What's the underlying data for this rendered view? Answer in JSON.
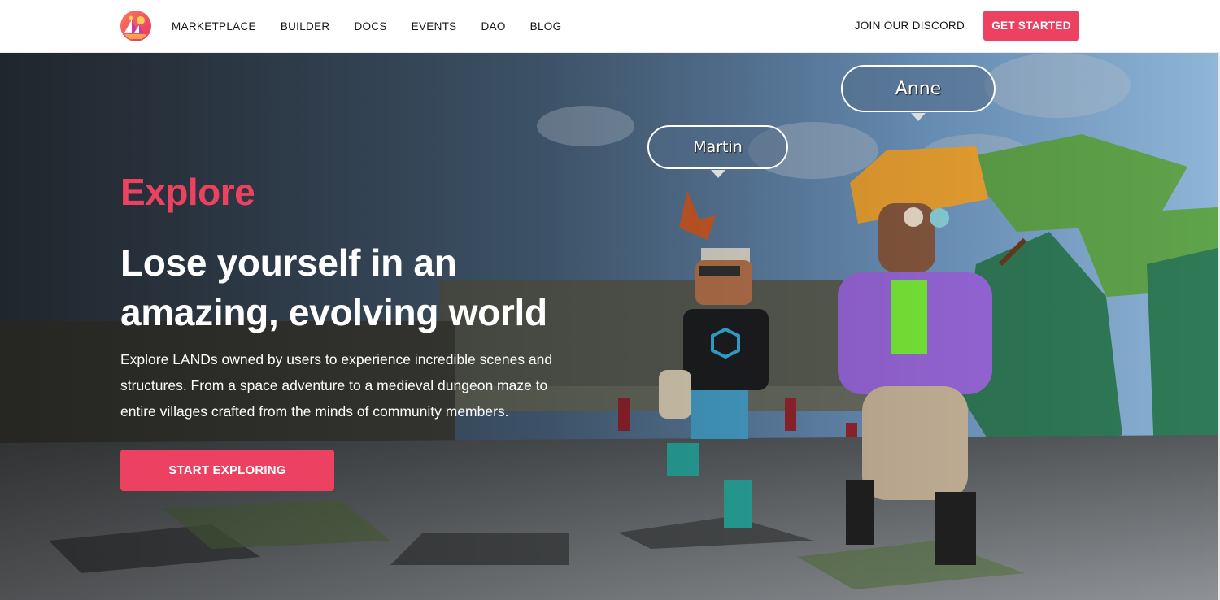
{
  "navbar": {
    "logo": "decentraland-logo-icon",
    "links": [
      "MARKETPLACE",
      "BUILDER",
      "DOCS",
      "EVENTS",
      "DAO",
      "BLOG"
    ],
    "discord_label": "JOIN OUR DISCORD",
    "get_started_label": "GET STARTED"
  },
  "hero": {
    "eyebrow": "Explore",
    "title": "Lose yourself in an amazing, evolving world",
    "description": "Explore LANDs owned by users to experience incredible scenes and structures. From a space adventure to a medieval dungeon maze to entire villages crafted from the minds of community members.",
    "cta_label": "START EXPLORING",
    "avatars": [
      {
        "name": "Martin"
      },
      {
        "name": "Anne"
      }
    ]
  },
  "colors": {
    "accent": "#ec4160",
    "nav_text": "#16141a",
    "hero_text": "#ffffff"
  }
}
